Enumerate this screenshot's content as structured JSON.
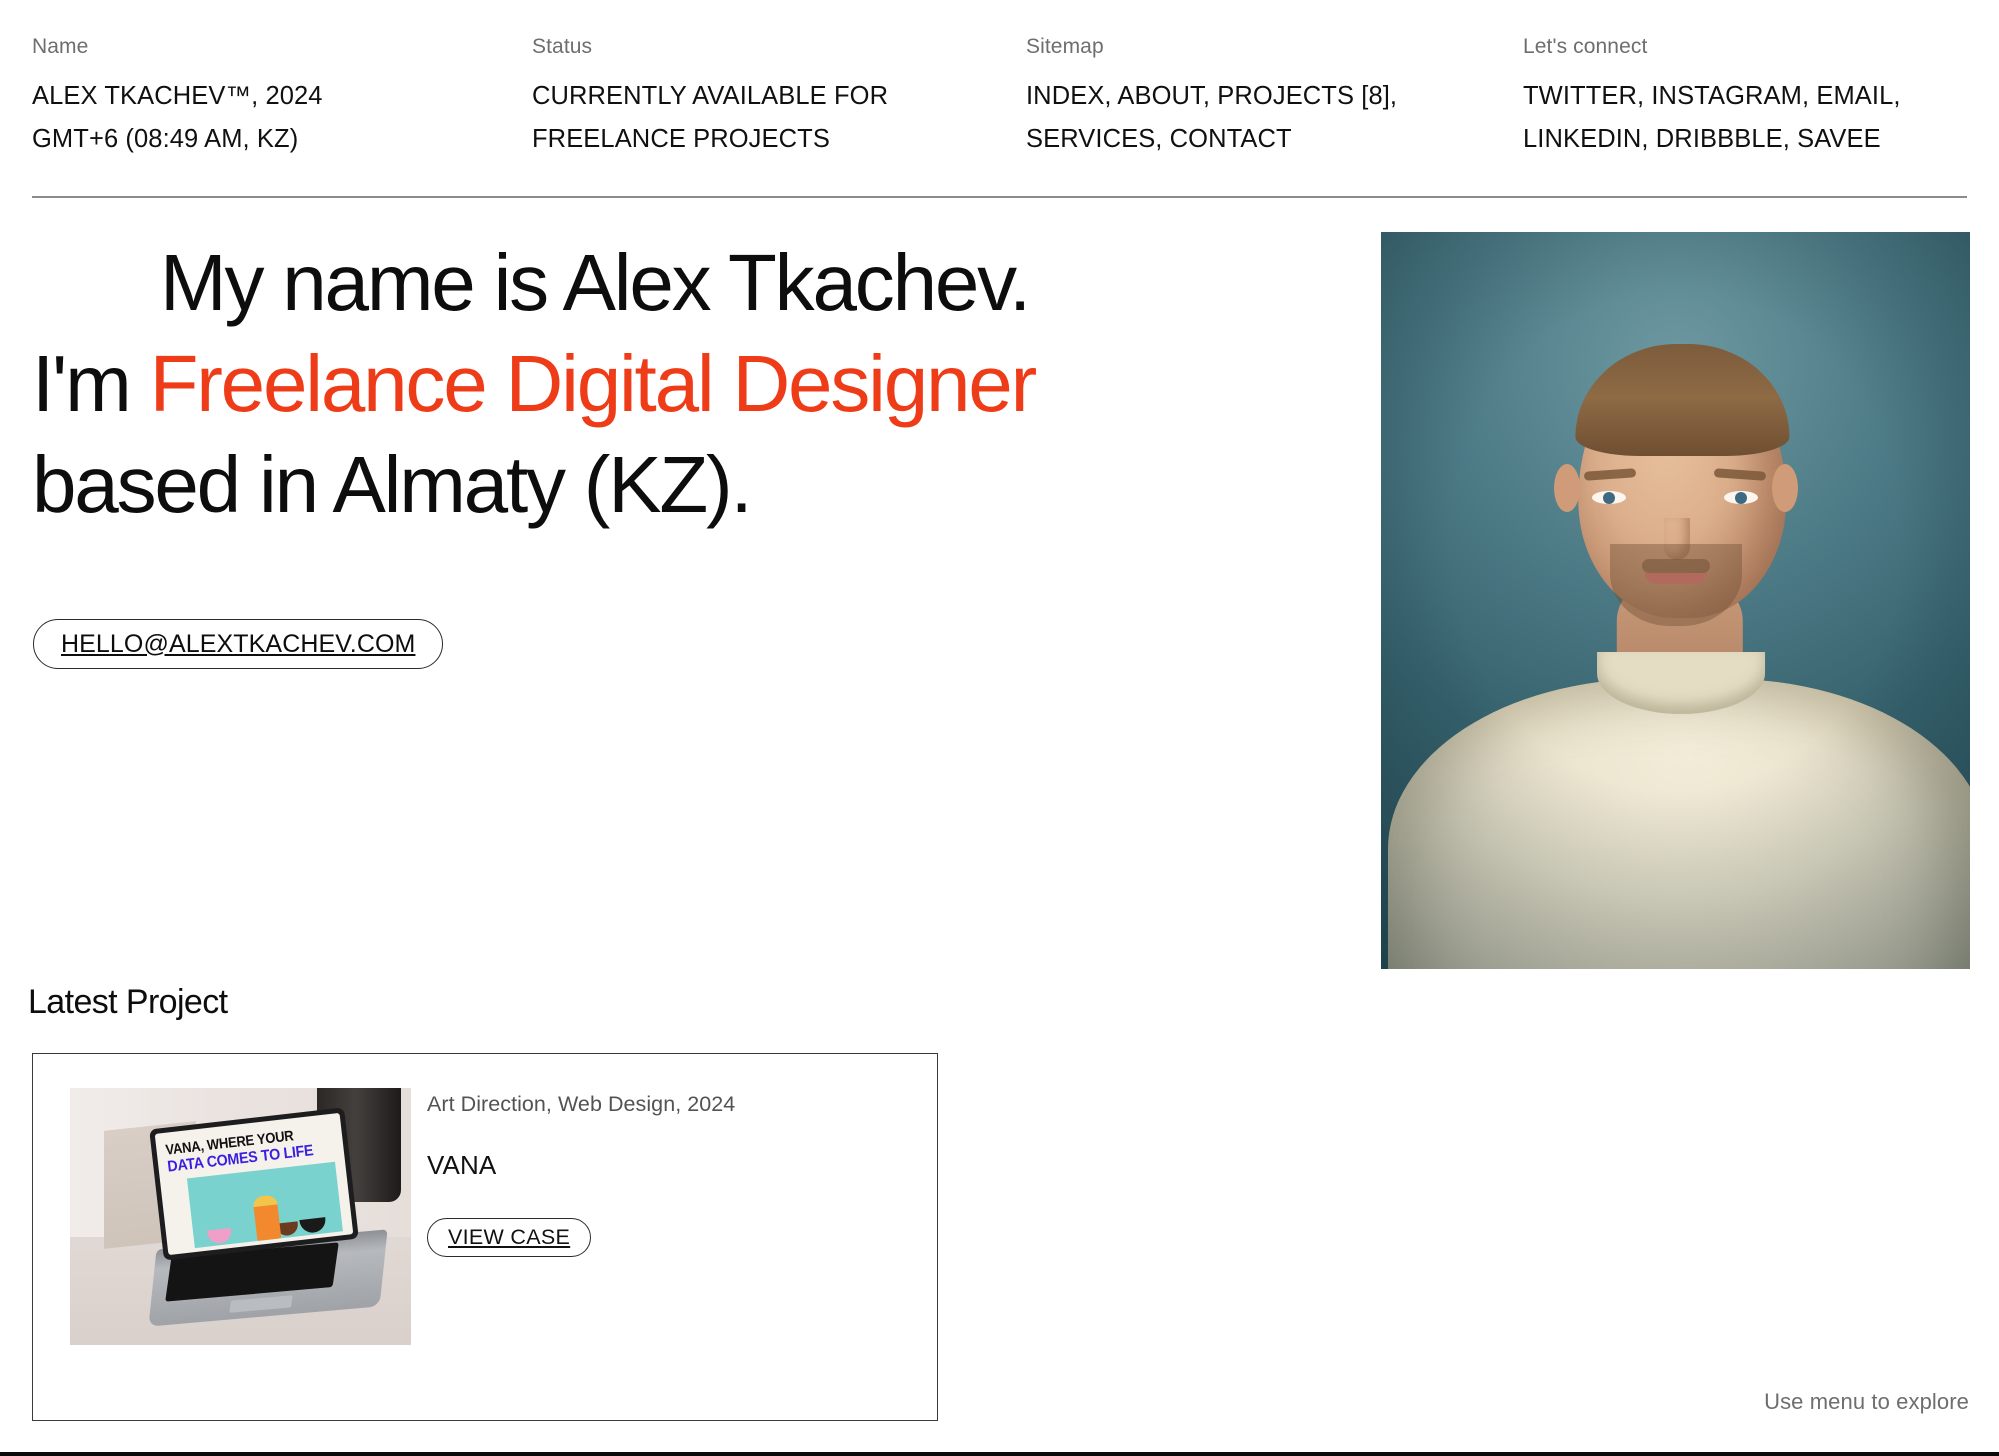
{
  "header": {
    "columns": [
      {
        "label": "Name",
        "lines": [
          "ALEX TKACHEV™, 2024",
          "GMT+6 (08:49 AM, KZ)"
        ]
      },
      {
        "label": "Status",
        "lines": [
          "CURRENTLY AVAILABLE FOR",
          "FREELANCE PROJECTS"
        ]
      },
      {
        "label": "Sitemap",
        "lines": [
          "INDEX, ABOUT, PROJECTS [8],",
          "SERVICES, CONTACT"
        ]
      },
      {
        "label": "Let's connect",
        "lines": [
          "TWITTER, INSTAGRAM, EMAIL,",
          "LINKEDIN, DRIBBBLE, SAVEE"
        ]
      }
    ]
  },
  "hero": {
    "line1": "My name is Alex Tkachev.",
    "line2_prefix": "I'm ",
    "line2_accent": "Freelance Digital Designer",
    "line3": "based in Almaty (KZ).",
    "accent_color": "#ef3c18",
    "email_button": "HELLO@ALEXTKACHEV.COM"
  },
  "portrait": {
    "alt": "Portrait photo of Alex Tkachev in a cream sweatshirt on a teal backdrop"
  },
  "latest_project": {
    "heading": "Latest Project",
    "meta": "Art Direction, Web Design, 2024",
    "title": "VANA",
    "cta": "VIEW CASE",
    "thumbnail": {
      "screen_line1": "VANA, WHERE YOUR",
      "screen_line2": "DATA COMES TO LIFE",
      "screen_line2_color": "#3b1fe0"
    }
  },
  "footer": {
    "hint": "Use menu to explore"
  }
}
